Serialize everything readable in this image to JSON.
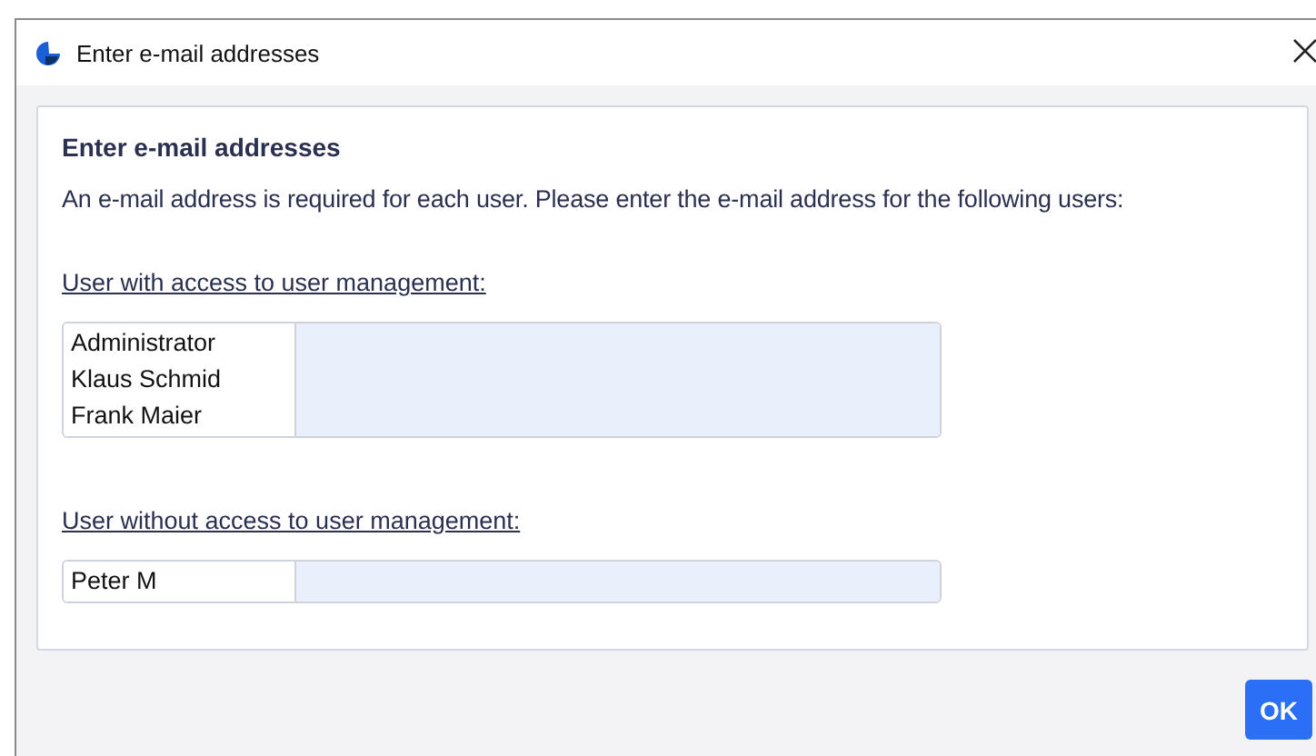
{
  "window": {
    "title": "Enter e-mail addresses"
  },
  "card": {
    "heading": "Enter e-mail addresses",
    "intro": "An e-mail address is required for each user. Please enter the e-mail address for the following users:"
  },
  "groups": [
    {
      "heading": "User with access to user management:",
      "users": [
        "Administrator",
        "Klaus Schmid",
        "Frank Maier"
      ]
    },
    {
      "heading": "User without access to user management:",
      "users": [
        "Peter M"
      ]
    }
  ],
  "buttons": [
    "OK"
  ]
}
